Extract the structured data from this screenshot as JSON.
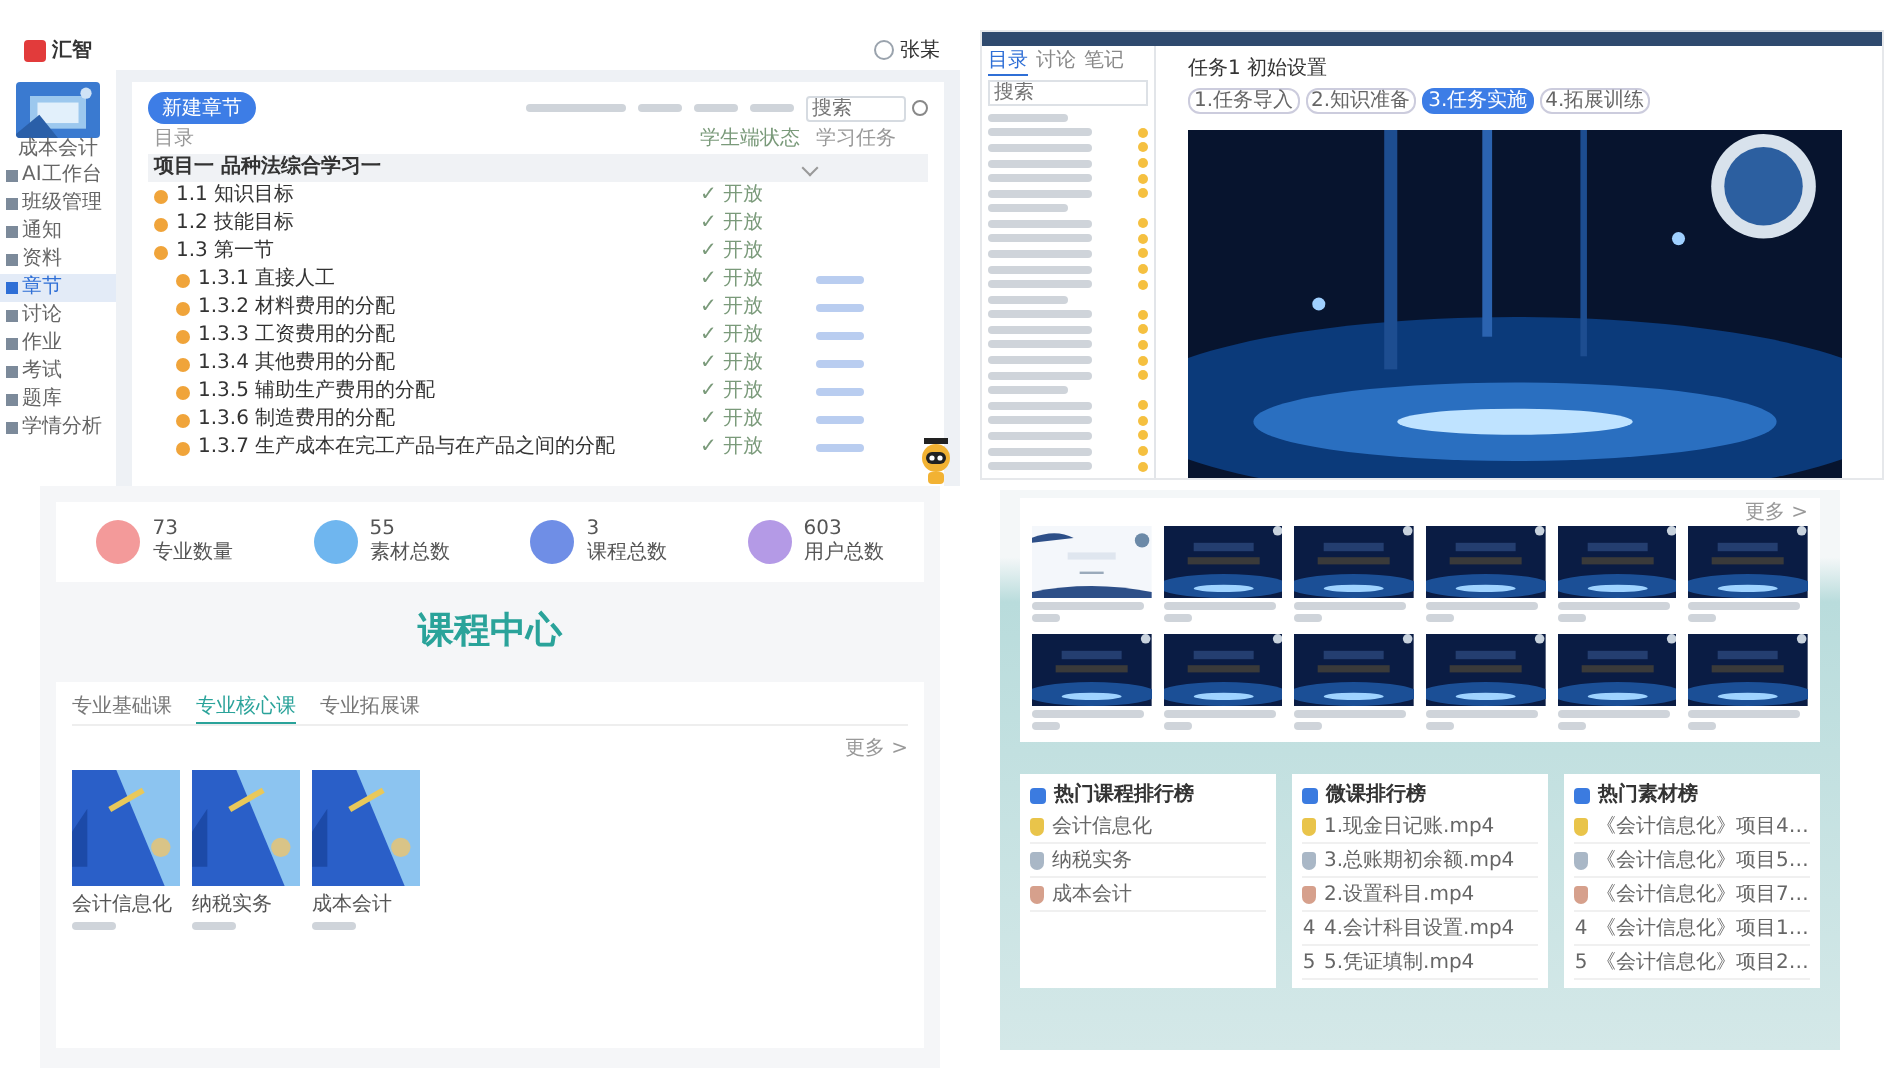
{
  "course_admin": {
    "logo": "汇智",
    "user": "张某",
    "sidebar": {
      "course_title": "成本会计",
      "items": [
        {
          "label": "AI工作台",
          "selected": false
        },
        {
          "label": "班级管理",
          "selected": false
        },
        {
          "label": "通知",
          "selected": false
        },
        {
          "label": "资料",
          "selected": false
        },
        {
          "label": "章节",
          "selected": true
        },
        {
          "label": "讨论",
          "selected": false
        },
        {
          "label": "作业",
          "selected": false
        },
        {
          "label": "考试",
          "selected": false
        },
        {
          "label": "题库",
          "selected": false
        },
        {
          "label": "学情分析",
          "selected": false
        }
      ]
    },
    "new_button": "新建章节",
    "search": {
      "placeholder": "搜索"
    },
    "columns": [
      "目录",
      "学生端状态",
      "学习任务"
    ],
    "group": {
      "label": "项目一 品种法综合学习一",
      "expanded": true
    },
    "rows": [
      {
        "label": "1.1 知识目标",
        "status": "✓ 开放",
        "has_task": false
      },
      {
        "label": "1.2 技能目标",
        "status": "✓ 开放",
        "has_task": false
      },
      {
        "label": "1.3 第一节",
        "status": "✓ 开放",
        "has_task": false
      },
      {
        "label": "1.3.1 直接人工",
        "status": "✓ 开放",
        "has_task": true
      },
      {
        "label": "1.3.2 材料费用的分配",
        "status": "✓ 开放",
        "has_task": true
      },
      {
        "label": "1.3.3 工资费用的分配",
        "status": "✓ 开放",
        "has_task": true
      },
      {
        "label": "1.3.4 其他费用的分配",
        "status": "✓ 开放",
        "has_task": true
      },
      {
        "label": "1.3.5 辅助生产费用的分配",
        "status": "✓ 开放",
        "has_task": true
      },
      {
        "label": "1.3.6 制造费用的分配",
        "status": "✓ 开放",
        "has_task": true
      },
      {
        "label": "1.3.7 生产成本在完工产品与在产品之间的分配",
        "status": "✓ 开放",
        "has_task": true
      }
    ]
  },
  "player": {
    "sidebar_tabs": [
      {
        "label": "目录",
        "selected": true
      },
      {
        "label": "讨论",
        "selected": false
      },
      {
        "label": "笔记",
        "selected": false
      }
    ],
    "search": {
      "placeholder": "搜索"
    },
    "title": "任务1 初始设置",
    "steps": [
      {
        "label": "1.任务导入",
        "selected": false
      },
      {
        "label": "2.知识准备",
        "selected": false
      },
      {
        "label": "3.任务实施",
        "selected": true
      },
      {
        "label": "4.拓展训练",
        "selected": false
      }
    ]
  },
  "portal": {
    "stats": [
      {
        "value": "73",
        "label": "专业数量",
        "color": "#f39a9a"
      },
      {
        "value": "55",
        "label": "素材总数",
        "color": "#6fb6ef"
      },
      {
        "value": "3",
        "label": "课程总数",
        "color": "#6f8ee6"
      },
      {
        "value": "603",
        "label": "用户总数",
        "color": "#b49ae6"
      }
    ],
    "heading": "课程中心",
    "tabs": [
      {
        "label": "专业基础课",
        "selected": false
      },
      {
        "label": "专业核心课",
        "selected": true
      },
      {
        "label": "专业拓展课",
        "selected": false
      }
    ],
    "more": "更多 >",
    "courses": [
      {
        "title": "会计信息化"
      },
      {
        "title": "纳税实务"
      },
      {
        "title": "成本会计"
      }
    ]
  },
  "resources": {
    "more": "更多 >",
    "thumbnails": [
      {
        "kind": "slide"
      },
      {
        "kind": "video"
      },
      {
        "kind": "video"
      },
      {
        "kind": "video"
      },
      {
        "kind": "video"
      },
      {
        "kind": "video"
      },
      {
        "kind": "video"
      },
      {
        "kind": "video"
      },
      {
        "kind": "video"
      },
      {
        "kind": "video"
      },
      {
        "kind": "video"
      },
      {
        "kind": "video"
      }
    ],
    "boards": [
      {
        "title": "热门课程排行榜",
        "items": [
          {
            "label": "会计信息化"
          },
          {
            "label": "纳税实务"
          },
          {
            "label": "成本会计"
          }
        ]
      },
      {
        "title": "微课排行榜",
        "items": [
          {
            "label": "1.现金日记账.mp4"
          },
          {
            "label": "3.总账期初余额.mp4"
          },
          {
            "label": "2.设置科目.mp4"
          },
          {
            "rank": "4",
            "label": "4.会计科目设置.mp4"
          },
          {
            "rank": "5",
            "label": "5.凭证填制.mp4"
          }
        ]
      },
      {
        "title": "热门素材榜",
        "items": [
          {
            "label": "《会计信息化》项目4…"
          },
          {
            "label": "《会计信息化》项目5…"
          },
          {
            "label": "《会计信息化》项目7…"
          },
          {
            "rank": "4",
            "label": "《会计信息化》项目1…"
          },
          {
            "rank": "5",
            "label": "《会计信息化》项目2…"
          }
        ]
      }
    ]
  }
}
